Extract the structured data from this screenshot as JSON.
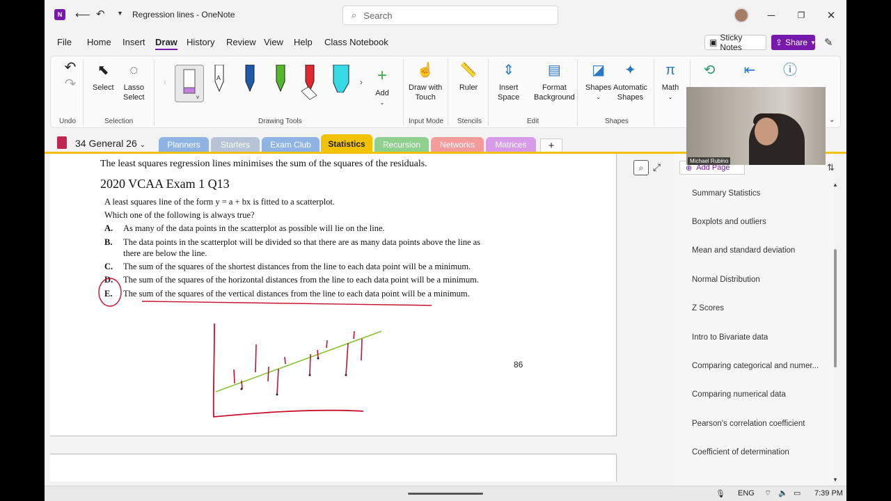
{
  "window": {
    "title": "Regression lines  -  OneNote",
    "search_placeholder": "Search"
  },
  "menu": {
    "items": [
      "File",
      "Home",
      "Insert",
      "Draw",
      "History",
      "Review",
      "View",
      "Help",
      "Class Notebook"
    ],
    "active": "Draw",
    "sticky_notes": "Sticky Notes",
    "share": "Share"
  },
  "ribbon": {
    "undo": "Undo",
    "select": "Select",
    "lasso_select_1": "Lasso",
    "lasso_select_2": "Select",
    "group_selection": "Selection",
    "group_drawing_tools": "Drawing Tools",
    "add": "Add",
    "draw_with_touch_1": "Draw with",
    "draw_with_touch_2": "Touch",
    "group_input_mode": "Input Mode",
    "ruler": "Ruler",
    "group_stencils": "Stencils",
    "insert_space_1": "Insert",
    "insert_space_2": "Space",
    "format_background_1": "Format",
    "format_background_2": "Background",
    "group_edit": "Edit",
    "shapes": "Shapes",
    "automatic_shapes_1": "Automatic",
    "automatic_shapes_2": "Shapes",
    "group_shapes": "Shapes",
    "math": "Math",
    "pen_colors": [
      "#ffffff",
      "#1a1a1a",
      "#1e5aa8",
      "#53b82a",
      "#e0282e",
      "#38d9e6"
    ]
  },
  "notebook": {
    "name": "34 General 26",
    "tabs": [
      {
        "label": "Planners",
        "color": "#8fb4e3"
      },
      {
        "label": "Starters",
        "color": "#b7c3d6"
      },
      {
        "label": "Exam Club",
        "color": "#8fb4e3"
      },
      {
        "label": "Statistics",
        "color": "#f2c200"
      },
      {
        "label": "Recursion",
        "color": "#8fd08f"
      },
      {
        "label": "Networks",
        "color": "#f49b9b"
      },
      {
        "label": "Matrices",
        "color": "#d79be8"
      }
    ]
  },
  "page": {
    "heading_note": "The least squares regression lines minimises the sum of the squares of the residuals.",
    "question_title": "2020 VCAA Exam 1 Q13",
    "stem_1": "A least squares line of the form y = a + bx is fitted to a scatterplot.",
    "stem_2": "Which one of the following is always true?",
    "options": [
      {
        "letter": "A.",
        "text": "As many of the data points in the scatterplot as possible will lie on the line."
      },
      {
        "letter": "B.",
        "text": "The data points in the scatterplot will be divided so that there are as many data points above the line as"
      },
      {
        "letter": "",
        "text": "there are below the line."
      },
      {
        "letter": "C.",
        "text": "The sum of the squares of the shortest distances from the line to each data point will be a minimum."
      },
      {
        "letter": "D.",
        "text": "The sum of the squares of the horizontal distances from the line to each data point will be a minimum."
      },
      {
        "letter": "E.",
        "text": "The sum of the squares of the vertical distances from the line to each data point will be a minimum."
      }
    ],
    "page_number": "86"
  },
  "pages_pane": {
    "add_page": "Add Page",
    "items": [
      "Summary Statistics",
      "Boxplots and outliers",
      "Mean and standard deviation",
      "Normal Distribution",
      "Z Scores",
      "Intro to Bivariate data",
      "Comparing categorical and numer...",
      "Comparing numerical data",
      "Pearson's correlation coefficient",
      "Coefficient of determination"
    ]
  },
  "webcam": {
    "name": "Michael Rubino"
  },
  "taskbar": {
    "language": "ENG",
    "time": "7:39 PM"
  }
}
